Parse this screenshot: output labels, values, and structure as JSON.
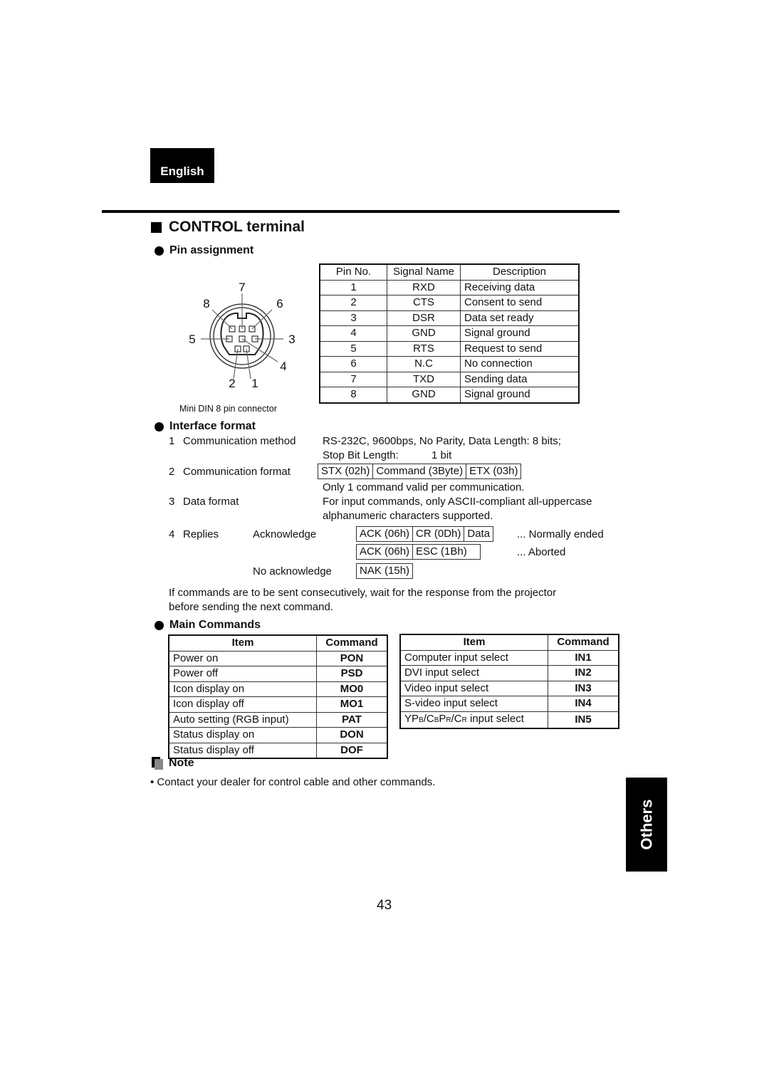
{
  "language_tab": "English",
  "section_title": "CONTROL terminal",
  "pin_assignment": {
    "heading": "Pin assignment",
    "connector_caption": "Mini DIN 8 pin connector",
    "connector_pin_labels": [
      "1",
      "2",
      "3",
      "4",
      "5",
      "6",
      "7",
      "8"
    ],
    "table": {
      "headers": [
        "Pin No.",
        "Signal Name",
        "Description"
      ],
      "rows": [
        [
          "1",
          "RXD",
          "Receiving data"
        ],
        [
          "2",
          "CTS",
          "Consent to send"
        ],
        [
          "3",
          "DSR",
          "Data set ready"
        ],
        [
          "4",
          "GND",
          "Signal ground"
        ],
        [
          "5",
          "RTS",
          "Request to send"
        ],
        [
          "6",
          "N.C",
          "No connection"
        ],
        [
          "7",
          "TXD",
          "Sending data"
        ],
        [
          "8",
          "GND",
          "Signal ground"
        ]
      ]
    }
  },
  "interface_format": {
    "heading": "Interface format",
    "items": [
      {
        "num": "1",
        "label": "Communication method",
        "lines": [
          "RS-232C, 9600bps, No Parity, Data Length: 8 bits;"
        ],
        "stop_bit_label": "Stop Bit Length:",
        "stop_bit_value": "1 bit"
      },
      {
        "num": "2",
        "label": "Communication format",
        "boxes": [
          "STX (02h)",
          "Command (3Byte)",
          "ETX (03h)"
        ],
        "note": "Only 1 command valid per communication."
      },
      {
        "num": "3",
        "label": "Data format",
        "lines": [
          "For input commands, only ASCII-compliant all-uppercase",
          "alphanumeric characters supported."
        ]
      },
      {
        "num": "4",
        "label": "Replies",
        "ack_label": "Acknowledge",
        "ack_normal": [
          "ACK (06h)",
          "CR (0Dh)",
          "Data"
        ],
        "ack_normal_result": "... Normally ended",
        "ack_abort": [
          "ACK (06h)",
          "ESC (1Bh)"
        ],
        "ack_abort_result": "... Aborted",
        "nak_label": "No acknowledge",
        "nak": [
          "NAK (15h)"
        ]
      }
    ],
    "consecutive_note": [
      "If commands are to be sent consecutively, wait for the response from the projector",
      "before sending the next command."
    ]
  },
  "main_commands": {
    "heading": "Main Commands",
    "headers": [
      "Item",
      "Command"
    ],
    "left_rows": [
      [
        "Power on",
        "PON"
      ],
      [
        "Power off",
        "PSD"
      ],
      [
        "Icon display on",
        "MO0"
      ],
      [
        "Icon display off",
        "MO1"
      ],
      [
        "Auto setting (RGB input)",
        "PAT"
      ],
      [
        "Status display on",
        "DON"
      ],
      [
        "Status display off",
        "DOF"
      ]
    ],
    "right_rows": [
      [
        "Computer input select",
        "IN1"
      ],
      [
        "DVI input select",
        "IN2"
      ],
      [
        "Video input select",
        "IN3"
      ],
      [
        "S-video input select",
        "IN4"
      ],
      [
        "YPB/CBPR/CR input select",
        "IN5"
      ]
    ]
  },
  "note": {
    "heading": "Note",
    "bullets": [
      "Contact your dealer for control cable and other commands."
    ]
  },
  "side_tab": "Others",
  "page_number": "43"
}
